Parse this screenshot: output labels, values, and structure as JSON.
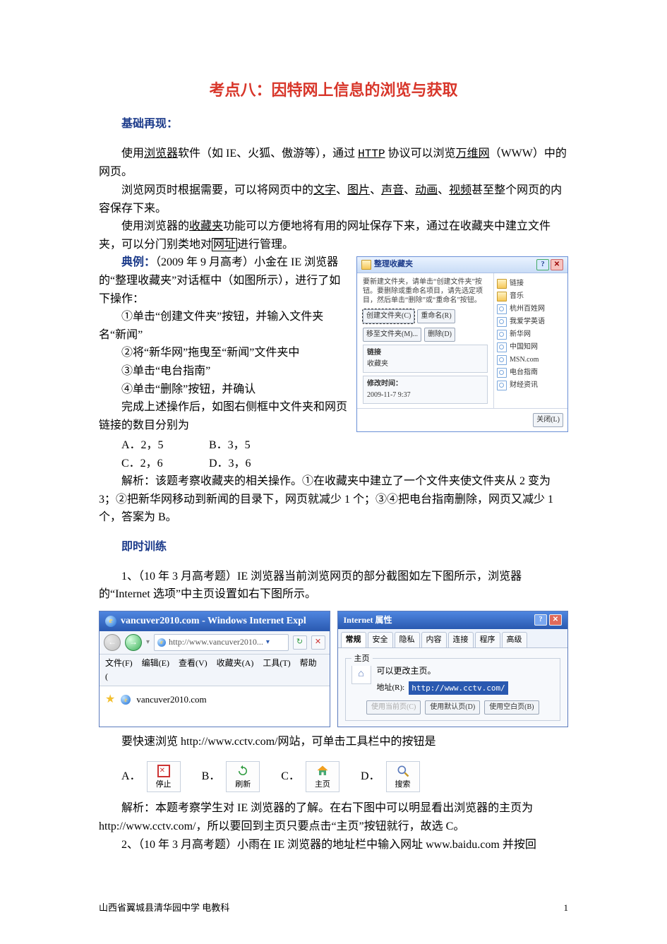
{
  "title": "考点八：因特网上信息的浏览与获取",
  "sections": {
    "s1": "基础再现：",
    "s2": "即时训练"
  },
  "body": {
    "p1a": "使用",
    "p1b": "浏览器",
    "p1c": "软件（如 IE、火狐、傲游等），通过 ",
    "p1d": "HTTP",
    "p1e": " 协议可以浏览",
    "p1f": "万维网",
    "p1g": "（WWW）中的网页。",
    "p2a": "浏览网页时根据需要，可以将网页中的",
    "p2b": "文字",
    "p2c": "、",
    "p2d": "图片",
    "p2e": "、",
    "p2f": "声音",
    "p2g": "、",
    "p2h": "动画",
    "p2i": "、",
    "p2j": "视频",
    "p2k": "甚至整个网页的内容保存下来。",
    "p3a": "使用浏览器的",
    "p3b": "收藏夹",
    "p3c": "功能可以方便地将有用的网址保存下来，通过在收藏夹中建立文件夹，可以分门别类地对",
    "p3d": "网址",
    "p3e": "进行管理。",
    "ex_label": "典例：",
    "ex_text1": "（2009 年 9 月高考）小金在 IE 浏览器的“整理收藏夹”对话框中（如图所示），进行了如下操作：",
    "step1": "①单击“创建文件夹”按钮，并输入文件夹名“新闻”",
    "step2": "②将“新华网”拖曳至“新闻”文件夹中",
    "step3": "③单击“电台指南”",
    "step4": "④单击“删除”按钮，并确认",
    "ex_text2": "完成上述操作后，如图右侧框中文件夹和网页链接的数目分别为",
    "choices": {
      "A": "A．2，5",
      "B": "B．3，5",
      "C": "C．2，6",
      "D": "D．3，6"
    },
    "analysis1": "解析：该题考察收藏夹的相关操作。①在收藏夹中建立了一个文件夹使文件夹从 2 变为 3；②把新华网移动到新闻的目录下，网页就减少 1 个；③④把电台指南删除，网页又减少 1 个，答案为 B。",
    "q1_lead": "1、（10 年 3 月高考题）IE 浏览器当前浏览网页的部分截图如左下图所示，浏览器的“Internet 选项”中主页设置如右下图所示。",
    "q1_ask": "要快速浏览 http://www.cctv.com/网站，可单击工具栏中的按钮是",
    "q1_opts": {
      "A": "A．",
      "B": "B．",
      "C": "C．",
      "D": "D．"
    },
    "q1_btn": {
      "stop": "停止",
      "refresh": "刷新",
      "home": "主页",
      "search": "搜索"
    },
    "analysis2": "解析：本题考察学生对 IE 浏览器的了解。在右下图中可以明显看出浏览器的主页为 http://www.cctv.com/，所以要回到主页只要点击“主页”按钮就行，故选 C。",
    "q2_lead": "2、（10 年 3 月高考题）小雨在 IE 浏览器的地址栏中输入网址 www.baidu.com 并按回"
  },
  "dialog": {
    "title": "整理收藏夹",
    "instructions": "要新建文件夹，请单击“创建文件夹”按钮。要删除或重命名项目，请先选定项目，然后单击“删除”或“重命名”按钮。",
    "btn_create": "创建文件夹(C)",
    "btn_rename": "重命名(R)",
    "btn_move": "移至文件夹(M)...",
    "btn_delete": "删除(D)",
    "sel_name": "链接",
    "sel_type": "收藏夹",
    "mod_label": "修改时间：",
    "mod_value": "2009-11-7 9:37",
    "close": "关闭(L)",
    "items": [
      "链接",
      "音乐",
      "杭州百姓网",
      "我爱学英语",
      "新华网",
      "中国知网",
      "MSN.com",
      "电台指南",
      "财经资讯"
    ]
  },
  "ie": {
    "title": "vancuver2010.com - Windows Internet Expl",
    "addr": "http://www.vancuver2010...",
    "menus": [
      "文件(F)",
      "编辑(E)",
      "查看(V)",
      "收藏夹(A)",
      "工具(T)",
      "帮助("
    ],
    "fav": "vancuver2010.com"
  },
  "props": {
    "title": "Internet 属性",
    "tabs": [
      "常规",
      "安全",
      "隐私",
      "内容",
      "连接",
      "程序",
      "高级"
    ],
    "group": "主页",
    "hint": "可以更改主页。",
    "addr_label": "地址(R):",
    "addr_value": "http://www.cctv.com/",
    "btn_cur": "使用当前页(C)",
    "btn_def": "使用默认页(D)",
    "btn_blank": "使用空白页(B)"
  },
  "footer": {
    "left": "山西省翼城县清华园中学    电教科",
    "page": "1"
  }
}
